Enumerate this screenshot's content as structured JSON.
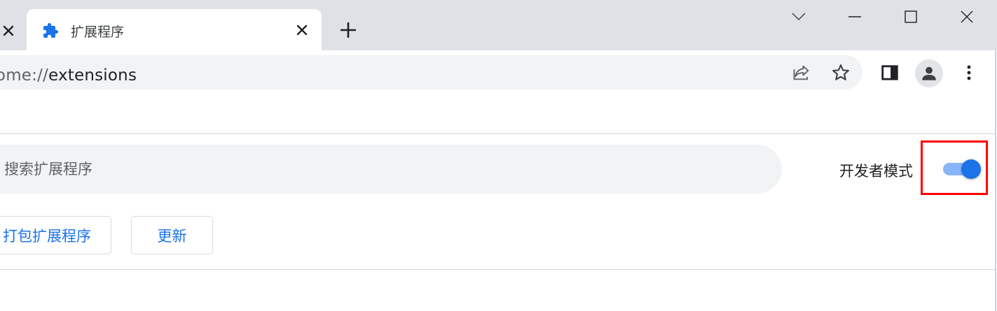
{
  "tabstrip": {
    "active_tab": {
      "title": "扩展程序",
      "icon": "puzzle-piece-icon"
    },
    "new_tab_icon": "plus-icon",
    "window_controls": [
      "chevron-down-icon",
      "minimize-icon",
      "maximize-icon",
      "close-icon"
    ]
  },
  "toolbar": {
    "url_scheme": "hrome://",
    "url_host": "extensions",
    "icons": [
      "share-icon",
      "star-icon",
      "side-panel-icon",
      "profile-icon",
      "more-vert-icon"
    ]
  },
  "extensions_page": {
    "search_placeholder": "搜索扩展程序",
    "developer_mode_label": "开发者模式",
    "developer_mode_enabled": true,
    "pack_button_label": "打包扩展程序",
    "update_button_label": "更新"
  },
  "colors": {
    "accent": "#1a73e8",
    "toggle_track": "#8ab4f8",
    "highlight": "#ff0000",
    "tabstrip_bg": "#dee1e6",
    "omnibox_bg": "#f1f3f4"
  }
}
